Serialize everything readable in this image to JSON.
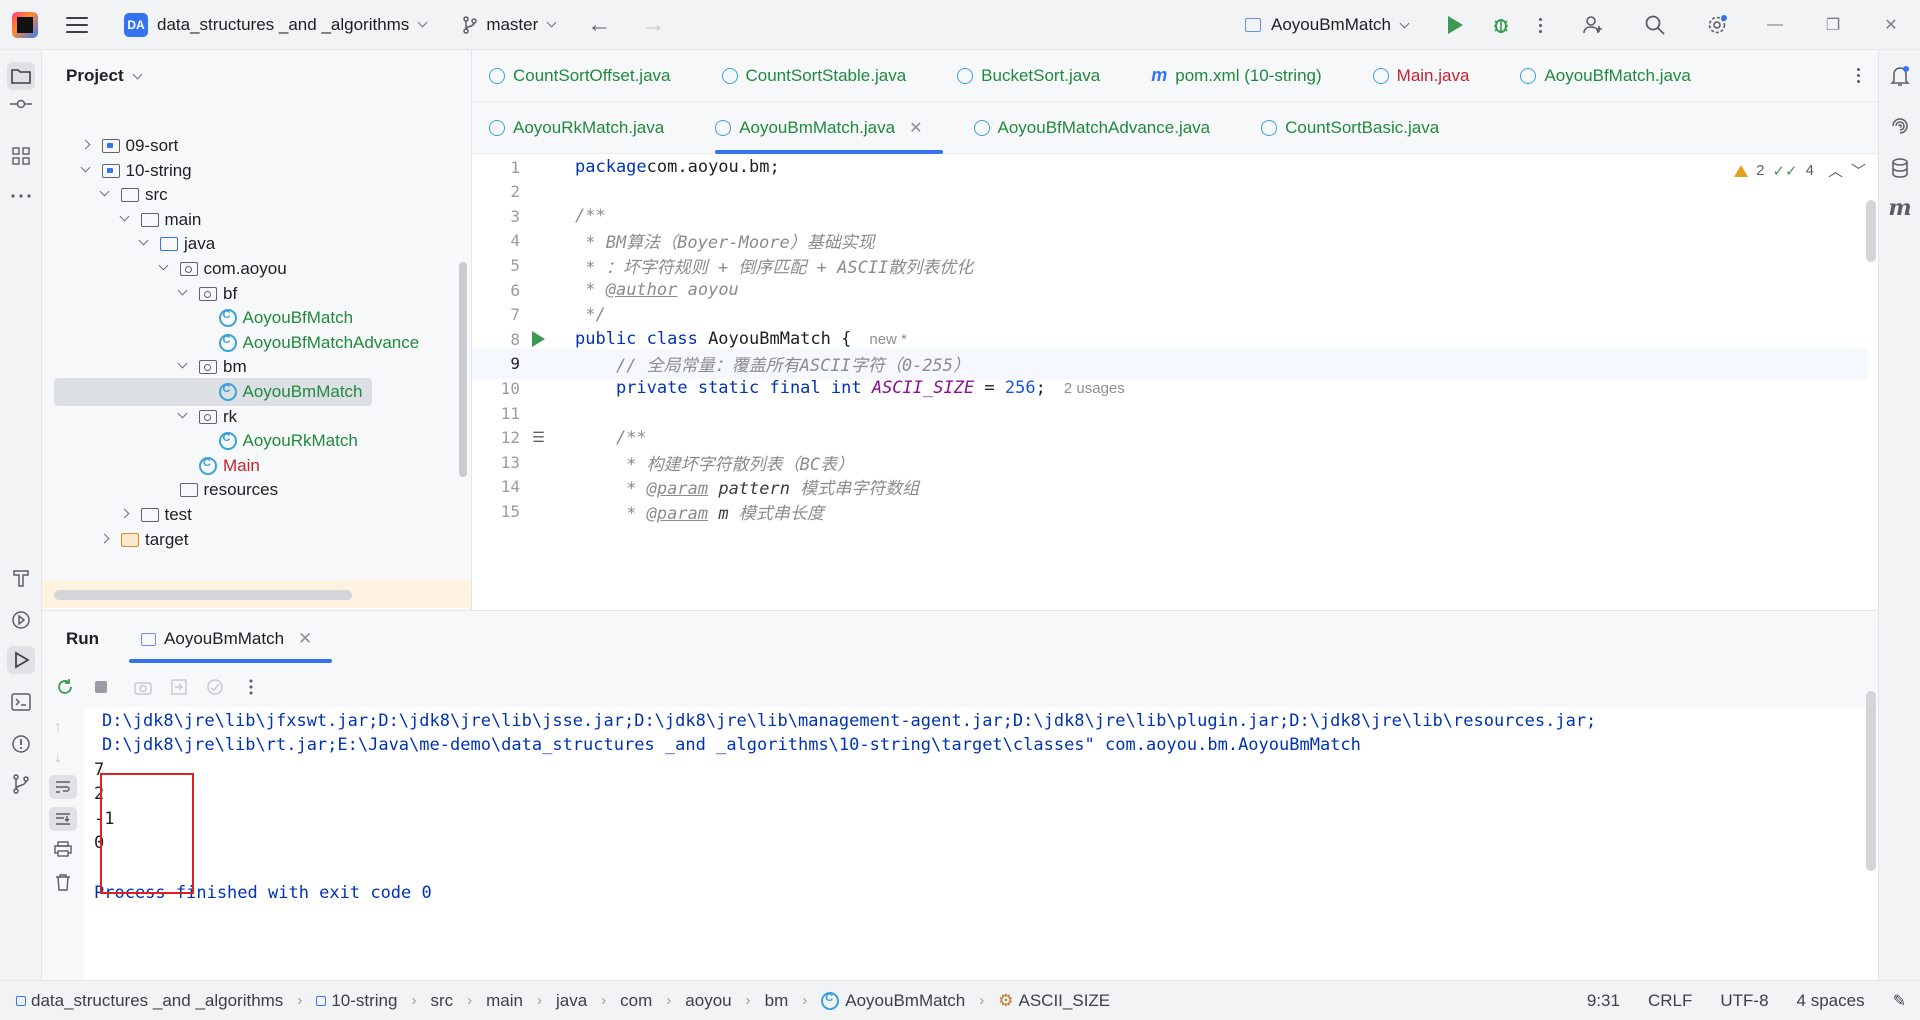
{
  "titlebar": {
    "project_badge": "DA",
    "project_name": "data_structures _and _algorithms",
    "branch": "master",
    "run_config": "AoyouBmMatch"
  },
  "project_panel": {
    "title": "Project",
    "tree": [
      {
        "label": "09-sort",
        "kind": "module",
        "expanded": false,
        "indent": 1
      },
      {
        "label": "10-string",
        "kind": "module",
        "expanded": true,
        "indent": 1
      },
      {
        "label": "src",
        "kind": "folder",
        "expanded": true,
        "indent": 2
      },
      {
        "label": "main",
        "kind": "folder",
        "expanded": true,
        "indent": 3
      },
      {
        "label": "java",
        "kind": "src-root",
        "expanded": true,
        "indent": 4
      },
      {
        "label": "com.aoyou",
        "kind": "package",
        "expanded": true,
        "indent": 5
      },
      {
        "label": "bf",
        "kind": "package",
        "expanded": true,
        "indent": 6
      },
      {
        "label": "AoyouBfMatch",
        "kind": "class",
        "indent": 7
      },
      {
        "label": "AoyouBfMatchAdvance",
        "kind": "class",
        "indent": 7
      },
      {
        "label": "bm",
        "kind": "package",
        "expanded": true,
        "indent": 6
      },
      {
        "label": "AoyouBmMatch",
        "kind": "class",
        "indent": 7,
        "selected": true
      },
      {
        "label": "rk",
        "kind": "package",
        "expanded": true,
        "indent": 6
      },
      {
        "label": "AoyouRkMatch",
        "kind": "class",
        "indent": 7
      },
      {
        "label": "Main",
        "kind": "class-red",
        "indent": 6
      },
      {
        "label": "resources",
        "kind": "resources",
        "indent": 5
      },
      {
        "label": "test",
        "kind": "folder",
        "expanded": false,
        "indent": 3
      },
      {
        "label": "target",
        "kind": "target",
        "expanded": false,
        "indent": 2
      }
    ]
  },
  "editor": {
    "tabs_row1": [
      {
        "label": "CountSortOffset.java",
        "icon": "class"
      },
      {
        "label": "CountSortStable.java",
        "icon": "class"
      },
      {
        "label": "BucketSort.java",
        "icon": "class"
      },
      {
        "label": "pom.xml (10-string)",
        "icon": "maven"
      },
      {
        "label": "Main.java",
        "icon": "class",
        "red": true
      },
      {
        "label": "AoyouBfMatch.java",
        "icon": "class"
      }
    ],
    "tabs_row2": [
      {
        "label": "AoyouRkMatch.java",
        "icon": "class"
      },
      {
        "label": "AoyouBmMatch.java",
        "icon": "class",
        "active": true
      },
      {
        "label": "AoyouBfMatchAdvance.java",
        "icon": "class"
      },
      {
        "label": "CountSortBasic.java",
        "icon": "class"
      }
    ],
    "warnings": "2",
    "checks": "4",
    "lines": [
      {
        "n": "1",
        "parts": [
          [
            "kw",
            "package"
          ],
          [
            "",
            "com.aoyou.bm;"
          ]
        ]
      },
      {
        "n": "2",
        "parts": []
      },
      {
        "n": "3",
        "parts": [
          [
            "doc",
            "/**"
          ]
        ]
      },
      {
        "n": "4",
        "parts": [
          [
            "doc",
            " * BM算法（Boyer-Moore）基础实现"
          ]
        ]
      },
      {
        "n": "5",
        "parts": [
          [
            "doc",
            " * ：坏字符规则 + 倒序匹配 + ASCII散列表优化"
          ]
        ]
      },
      {
        "n": "6",
        "parts": [
          [
            "doc",
            " * "
          ],
          [
            "tag",
            "@author"
          ],
          [
            "doc",
            " aoyou"
          ]
        ]
      },
      {
        "n": "7",
        "parts": [
          [
            "doc",
            " */"
          ]
        ]
      },
      {
        "n": "8",
        "parts": [
          [
            "kw",
            "public class "
          ],
          [
            "",
            "AoyouBmMatch {"
          ],
          [
            "hint",
            "new *"
          ]
        ],
        "gutter": "run"
      },
      {
        "n": "9",
        "parts": [
          [
            "",
            "    "
          ],
          [
            "cm",
            "// 全局常量：覆盖所有ASCII字符（0-255）"
          ]
        ],
        "current": true
      },
      {
        "n": "10",
        "parts": [
          [
            "",
            "    "
          ],
          [
            "kw",
            "private static final int "
          ],
          [
            "const",
            "ASCII_SIZE"
          ],
          [
            "",
            " = "
          ],
          [
            "num",
            "256"
          ],
          [
            "",
            ";"
          ],
          [
            "hint",
            "2 usages"
          ]
        ]
      },
      {
        "n": "11",
        "parts": []
      },
      {
        "n": "12",
        "parts": [
          [
            "",
            "    "
          ],
          [
            "doc",
            "/**"
          ]
        ],
        "gutter": "doc"
      },
      {
        "n": "13",
        "parts": [
          [
            "",
            "     "
          ],
          [
            "doc",
            "* 构建坏字符散列表（BC表）"
          ]
        ]
      },
      {
        "n": "14",
        "parts": [
          [
            "",
            "     "
          ],
          [
            "doc",
            "* "
          ],
          [
            "tag",
            "@param"
          ],
          [
            "docparam",
            " pattern"
          ],
          [
            "doc",
            " 模式串字符数组"
          ]
        ]
      },
      {
        "n": "15",
        "parts": [
          [
            "",
            "     "
          ],
          [
            "doc",
            "* "
          ],
          [
            "tag",
            "@param"
          ],
          [
            "docparam",
            " m"
          ],
          [
            "doc",
            " 模式串长度"
          ]
        ]
      }
    ]
  },
  "run_panel": {
    "title": "Run",
    "tab": "AoyouBmMatch",
    "console": [
      {
        "type": "cmd",
        "text": "D:\\jdk8\\jre\\lib\\jfxswt.jar;D:\\jdk8\\jre\\lib\\jsse.jar;D:\\jdk8\\jre\\lib\\management-agent.jar;D:\\jdk8\\jre\\lib\\plugin.jar;D:\\jdk8\\jre\\lib\\resources.jar;"
      },
      {
        "type": "cmd",
        "text": "D:\\jdk8\\jre\\lib\\rt.jar;E:\\Java\\me-demo\\data_structures _and _algorithms\\10-string\\target\\classes\" com.aoyou.bm.AoyouBmMatch"
      },
      {
        "type": "out",
        "text": "7"
      },
      {
        "type": "out",
        "text": "2"
      },
      {
        "type": "out",
        "text": "-1"
      },
      {
        "type": "out",
        "text": "0"
      },
      {
        "type": "blank",
        "text": ""
      },
      {
        "type": "cmd",
        "text": "Process finished with exit code 0"
      }
    ]
  },
  "statusbar": {
    "breadcrumbs": [
      "data_structures _and _algorithms",
      "10-string",
      "src",
      "main",
      "java",
      "com",
      "aoyou",
      "bm",
      "AoyouBmMatch",
      "ASCII_SIZE"
    ],
    "position": "9:31",
    "line_sep": "CRLF",
    "encoding": "UTF-8",
    "indent": "4 spaces"
  }
}
